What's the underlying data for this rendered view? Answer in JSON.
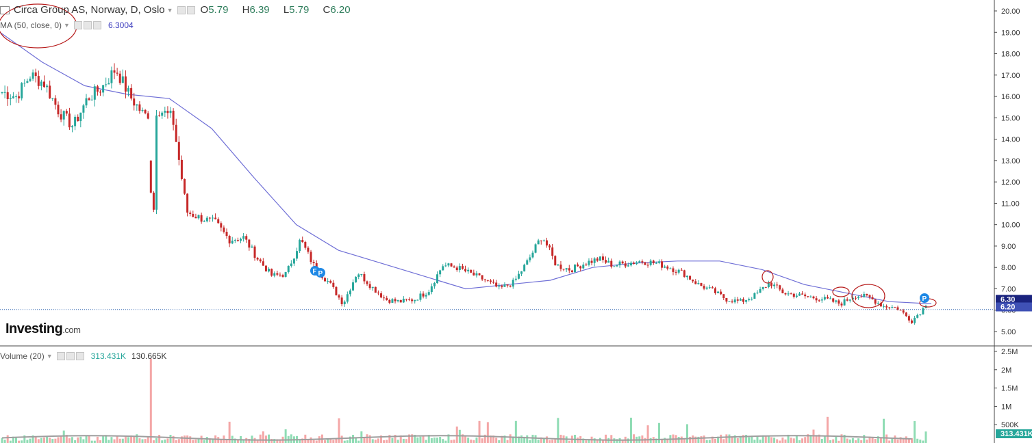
{
  "header": {
    "symbol_title": "Circa Group AS, Norway, D, Oslo",
    "ohlc": [
      {
        "label": "O",
        "value": "5.79"
      },
      {
        "label": "H",
        "value": "6.39"
      },
      {
        "label": "L",
        "value": "5.79"
      },
      {
        "label": "C",
        "value": "6.20"
      }
    ]
  },
  "ma_legend": {
    "label": "MA (50, close, 0)",
    "value": "6.3004"
  },
  "volume_legend": {
    "label": "Volume (20)",
    "value1": "313.431K",
    "value2": "130.665K"
  },
  "logo": {
    "main": "Investing",
    "suffix": ".com"
  },
  "colors": {
    "up": "#26a69a",
    "down": "#c62828",
    "ma": "#6f6fd6",
    "vol_up": "#8fdcb4",
    "vol_down": "#f4a7a7",
    "vol_ma": "#9e9e9e",
    "badge": "#1e88e5"
  },
  "icons": [
    "chart-type-icon",
    "eye-icon",
    "settings-icon",
    "close-icon",
    "dropdown-caret-icon"
  ],
  "event_markers": [
    "F",
    "P",
    "P"
  ],
  "chart_data": [
    {
      "type": "candlestick",
      "ylim": [
        4.5,
        20.3
      ],
      "y_ticks": [
        "20.00",
        "19.00",
        "18.00",
        "17.00",
        "16.00",
        "15.00",
        "14.00",
        "13.00",
        "12.00",
        "11.00",
        "10.00",
        "9.00",
        "8.00",
        "7.00",
        "6.00",
        "5.00"
      ],
      "price_labels": {
        "ma": "6.30",
        "last": "6.20"
      },
      "close_anchors": [
        16.2,
        16.0,
        17.0,
        16.6,
        15.3,
        14.6,
        15.9,
        16.4,
        17.3,
        16.0,
        15.1,
        15.4,
        15.0,
        10.6,
        10.3,
        10.1,
        9.3,
        9.4,
        8.4,
        7.6,
        7.7,
        9.3,
        8.0,
        7.3,
        6.3,
        7.8,
        7.1,
        6.5,
        6.4,
        6.5,
        6.9,
        8.1,
        8.0,
        7.7,
        7.4,
        7.0,
        7.3,
        8.3,
        9.5,
        8.1,
        7.9,
        8.2,
        8.4,
        8.1,
        8.2,
        8.3,
        8.2,
        8.0,
        7.7,
        7.2,
        6.9,
        6.5,
        6.4,
        6.7,
        7.3,
        6.8,
        6.7,
        6.6,
        6.5,
        6.3,
        6.7,
        6.6,
        6.2,
        6.1,
        5.5,
        6.2
      ],
      "series": [
        {
          "name": "MA (50, close, 0)",
          "last_value": 6.3004,
          "anchors": [
            19.0,
            17.6,
            16.5,
            16.1,
            15.9,
            14.5,
            12.2,
            10.0,
            8.8,
            8.2,
            7.6,
            7.0,
            7.2,
            7.4,
            8.0,
            8.2,
            8.3,
            8.3,
            7.9,
            7.2,
            6.8,
            6.4,
            6.3
          ]
        }
      ]
    },
    {
      "type": "bar",
      "name": "Volume (20)",
      "y_ticks": [
        "2.5M",
        "2M",
        "1.5M",
        "1M",
        "500K"
      ],
      "ylim": [
        0,
        2500000
      ],
      "last_values": [
        "313.431K",
        "130.665K"
      ]
    }
  ]
}
